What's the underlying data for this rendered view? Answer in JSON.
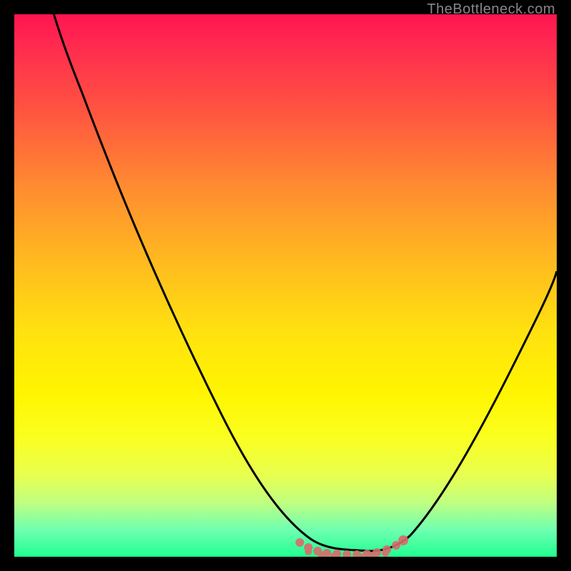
{
  "watermark": "TheBottleneck.com",
  "chart_data": {
    "type": "line",
    "title": "",
    "xlabel": "",
    "ylabel": "",
    "xlim": [
      0,
      100
    ],
    "ylim": [
      0,
      100
    ],
    "grid": false,
    "gradient_colors": {
      "top": "#ff1450",
      "upper_mid": "#ff8c30",
      "mid": "#ffe010",
      "lower_mid": "#faff20",
      "bottom": "#20ff90"
    },
    "series": [
      {
        "name": "bottleneck-curve",
        "color": "#000000",
        "x": [
          0,
          7,
          10,
          20,
          30,
          40,
          48,
          52,
          55,
          60,
          65,
          68,
          72,
          80,
          90,
          100
        ],
        "y": [
          110,
          100,
          95,
          76,
          57,
          38,
          20.5,
          11,
          5,
          2,
          1,
          1,
          2,
          10,
          30,
          55
        ]
      },
      {
        "name": "optimal-zone",
        "color": "#d96b6b",
        "marker_type": "dot",
        "x": [
          52,
          54,
          56,
          58,
          60,
          62,
          64,
          66,
          68,
          70,
          72
        ],
        "y_low": [
          10,
          6,
          3.5,
          2.3,
          1.6,
          1.2,
          1.0,
          1.1,
          1.3,
          1.7,
          2.5
        ],
        "y_high": [
          11,
          8,
          5.0,
          3.8,
          3.0,
          2.6,
          2.4,
          2.5,
          2.8,
          3.2,
          4.0
        ]
      }
    ],
    "notes": "No axes or tick labels present. Values estimated as percentage of plot width/height. Curve falls from upper-left corner to a trough near x≈62-68, then rises toward the right edge to about 55% of the plot height. The leftmost portion of the curve starts above the visible plot area. Pink patch marks optimal (low-bottleneck) region at bottom center."
  }
}
